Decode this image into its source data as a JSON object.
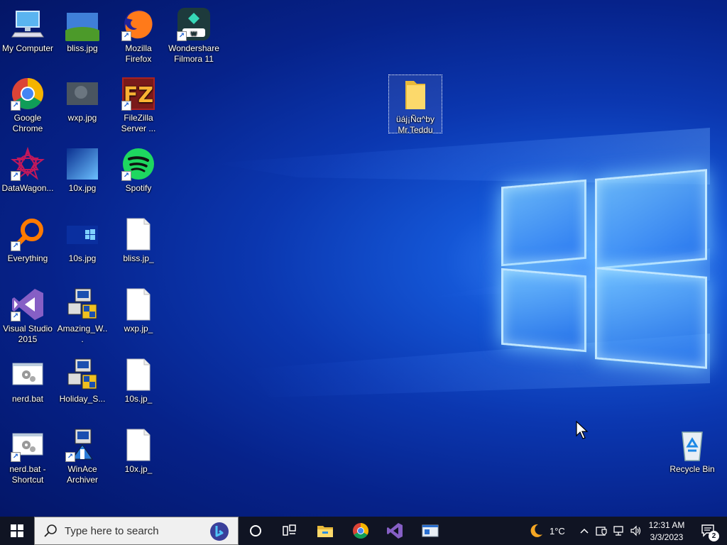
{
  "desktop": {
    "icons": [
      {
        "id": "my-computer",
        "label": "My Computer"
      },
      {
        "id": "bliss-jpg",
        "label": "bliss.jpg"
      },
      {
        "id": "mozilla-firefox",
        "label": "Mozilla Firefox"
      },
      {
        "id": "wondershare-filmora",
        "label": "Wondershare Filmora 11"
      },
      {
        "id": "google-chrome",
        "label": "Google Chrome"
      },
      {
        "id": "wxp-jpg",
        "label": "wxp.jpg"
      },
      {
        "id": "filezilla-server",
        "label": "FileZilla Server ..."
      },
      {
        "id": "datawagon",
        "label": "DataWagon..."
      },
      {
        "id": "10x-jpg",
        "label": "10x.jpg"
      },
      {
        "id": "spotify",
        "label": "Spotify"
      },
      {
        "id": "everything",
        "label": "Everything"
      },
      {
        "id": "10s-jpg",
        "label": "10s.jpg"
      },
      {
        "id": "bliss-jp_",
        "label": "bliss.jp_"
      },
      {
        "id": "visual-studio",
        "label": "Visual Studio 2015"
      },
      {
        "id": "amazing-w",
        "label": "Amazing_W..."
      },
      {
        "id": "wxp-jp_",
        "label": "wxp.jp_"
      },
      {
        "id": "nerd-bat",
        "label": "nerd.bat"
      },
      {
        "id": "holiday-s",
        "label": "Holiday_S..."
      },
      {
        "id": "10s-jp_",
        "label": "10s.jp_"
      },
      {
        "id": "nerd-bat-shortcut",
        "label": "nerd.bat - Shortcut"
      },
      {
        "id": "winace-archiver",
        "label": "WinAce Archiver"
      },
      {
        "id": "10x-jp_",
        "label": "10x.jp_"
      },
      {
        "id": "folder-teddu",
        "label": "üáj¡Ñα^by Mr.Teddu"
      },
      {
        "id": "recycle-bin",
        "label": "Recycle Bin"
      }
    ]
  },
  "taskbar": {
    "search_placeholder": "Type here to search",
    "pinned": [
      "cortana-circle-icon",
      "task-view-icon",
      "file-explorer-icon",
      "chrome-icon",
      "visual-studio-icon",
      "app-window-icon"
    ],
    "weather_temp": "1°C",
    "time": "12:31 AM",
    "date": "3/3/2023",
    "notification_count": "2"
  },
  "colors": {
    "taskbar_bg": "#101423",
    "wallpaper_accent": "#3d8cff"
  }
}
